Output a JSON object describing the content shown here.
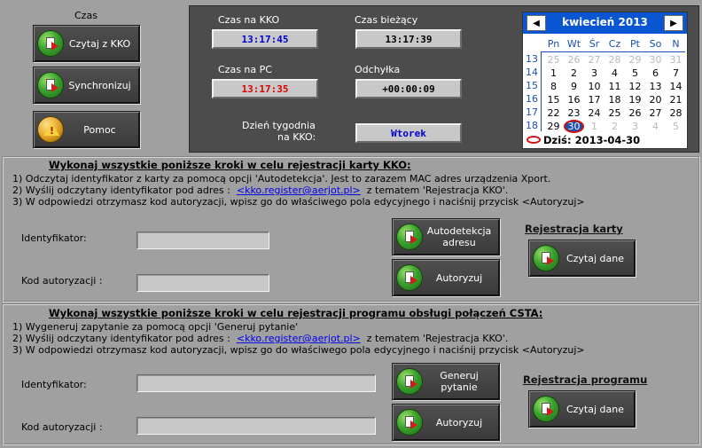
{
  "time": {
    "section_label": "Czas",
    "btn_read": "Czytaj z KKO",
    "btn_sync": "Synchronizuj",
    "btn_help": "Pomoc"
  },
  "clock": {
    "kko_label": "Czas na KKO",
    "kko_value": "13:17:45",
    "current_label": "Czas bieżący",
    "current_value": "13:17:39",
    "pc_label": "Czas na PC",
    "pc_value": "13:17:35",
    "deviation_label": "Odchyłka",
    "deviation_value": "+00:00:09",
    "weekday_label_1": "Dzień tygodnia",
    "weekday_label_2": "na KKO:",
    "weekday_value": "Wtorek"
  },
  "calendar": {
    "title": "kwiecień 2013",
    "prev": "◀",
    "next": "▶",
    "days": [
      "Pn",
      "Wt",
      "Śr",
      "Cz",
      "Pt",
      "So",
      "N"
    ],
    "weeks": [
      "13",
      "14",
      "15",
      "16",
      "17",
      "18"
    ],
    "rows": [
      [
        "25",
        "26",
        "27",
        "28",
        "29",
        "30",
        "31"
      ],
      [
        "1",
        "2",
        "3",
        "4",
        "5",
        "6",
        "7"
      ],
      [
        "8",
        "9",
        "10",
        "11",
        "12",
        "13",
        "14"
      ],
      [
        "15",
        "16",
        "17",
        "18",
        "19",
        "20",
        "21"
      ],
      [
        "22",
        "23",
        "24",
        "25",
        "26",
        "27",
        "28"
      ],
      [
        "29",
        "30",
        "1",
        "2",
        "3",
        "4",
        "5"
      ]
    ],
    "today": "Dziś: 2013-04-30"
  },
  "kko": {
    "title": "Wykonaj wszystkie poniższe kroki w celu rejestracji karty KKO:",
    "step1": "1) Odczytaj identyfikator z karty za pomocą opcji 'Autodetekcja'. Jest to zarazem MAC adres urządzenia Xport.",
    "step2_pre": "2) Wyślij odczytany identyfikator pod adres :",
    "step2_link": "<kko.register@aerjot.pl>",
    "step2_post": "z tematem 'Rejestracja KKO'.",
    "step3": "3) W odpowiedzi otrzymasz kod autoryzacji, wpisz go do właściwego pola edycyjnego i naciśnij przycisk <Autoryzuj>",
    "id_label": "Identyfikator:",
    "code_label": "Kod autoryzacji :",
    "btn_autodetect": "Autodetekcja adresu",
    "btn_authorize": "Autoryzuj",
    "reg_title": "Rejestracja karty",
    "btn_read": "Czytaj dane"
  },
  "csta": {
    "title": "Wykonaj wszystkie poniższe kroki w celu rejestracji programu obsługi połączeń CSTA:",
    "step1": "1) Wygeneruj zapytanie za pomocą opcji 'Generuj pytanie'",
    "step2_pre": "2) Wyślij odczytany identyfikator pod adres :",
    "step2_link": "<kko.register@aerjot.pl>",
    "step2_post": "z tematem 'Rejestracja KKO'.",
    "step3": "3) W odpowiedzi otrzymasz kod autoryzacji, wpisz go do właściwego pola edycyjnego i naciśnij przycisk <Autoryzuj>",
    "id_label": "Identyfikator:",
    "code_label": "Kod autoryzacji :",
    "btn_generate": "Generuj pytanie",
    "btn_authorize": "Autoryzuj",
    "reg_title": "Rejestracja programu",
    "btn_read": "Czytaj dane"
  },
  "colors": {
    "background": "#a0a0a0",
    "panel": "#4c4c4c",
    "calendar_header": "#0a55d0",
    "kko_time": "#0000cc",
    "pc_time": "#dd0000"
  }
}
